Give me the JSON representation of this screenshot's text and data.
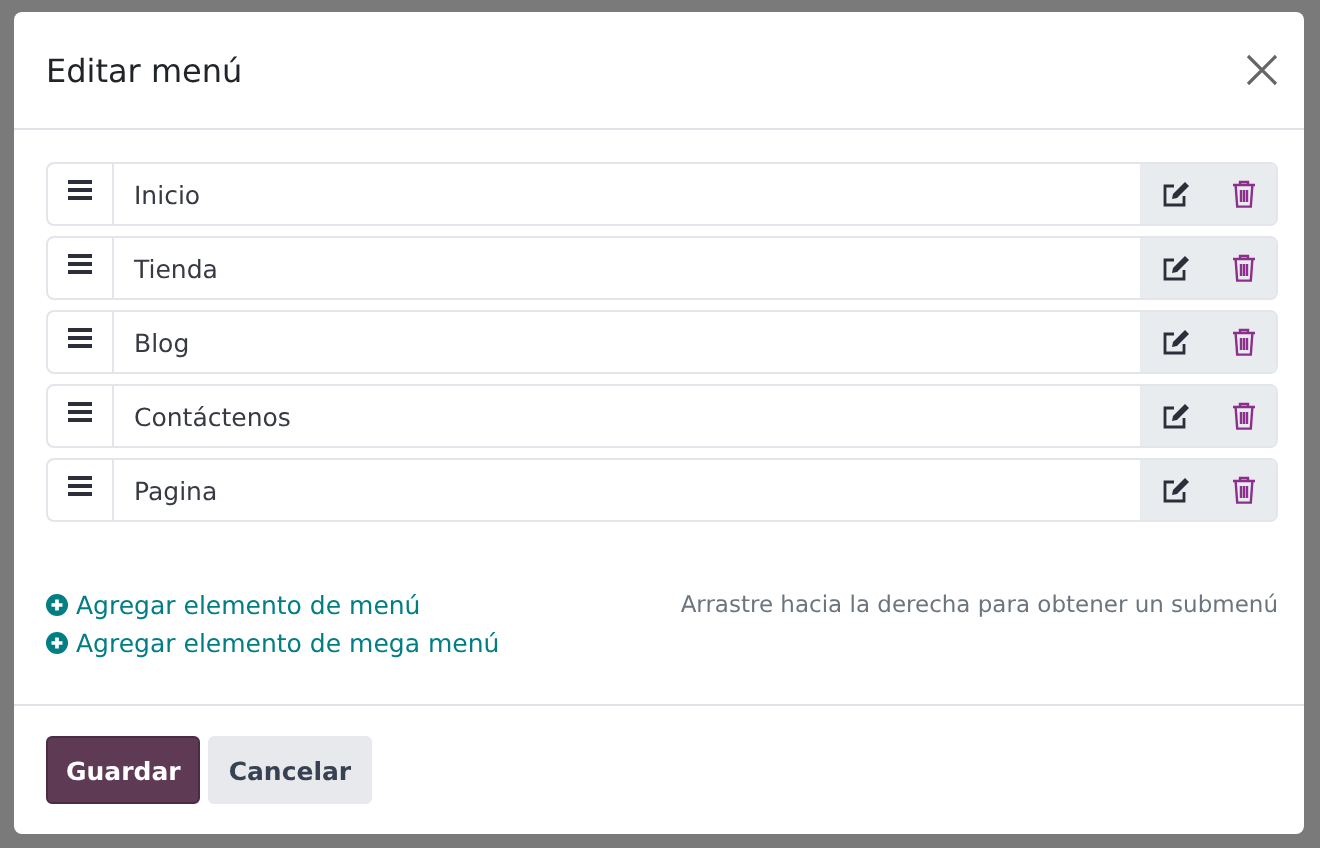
{
  "dialog": {
    "title": "Editar menú"
  },
  "menu_items": [
    {
      "label": "Inicio"
    },
    {
      "label": "Tienda"
    },
    {
      "label": "Blog"
    },
    {
      "label": "Contáctenos"
    },
    {
      "label": "Pagina"
    }
  ],
  "links": [
    "Agregar elemento de menú",
    "Agregar elemento de mega menú"
  ],
  "hint": "Arrastre hacia la derecha para obtener un submenú",
  "buttons": [
    {
      "label": "Guardar",
      "kind": "primary"
    },
    {
      "label": "Cancelar",
      "kind": "secondary"
    }
  ]
}
